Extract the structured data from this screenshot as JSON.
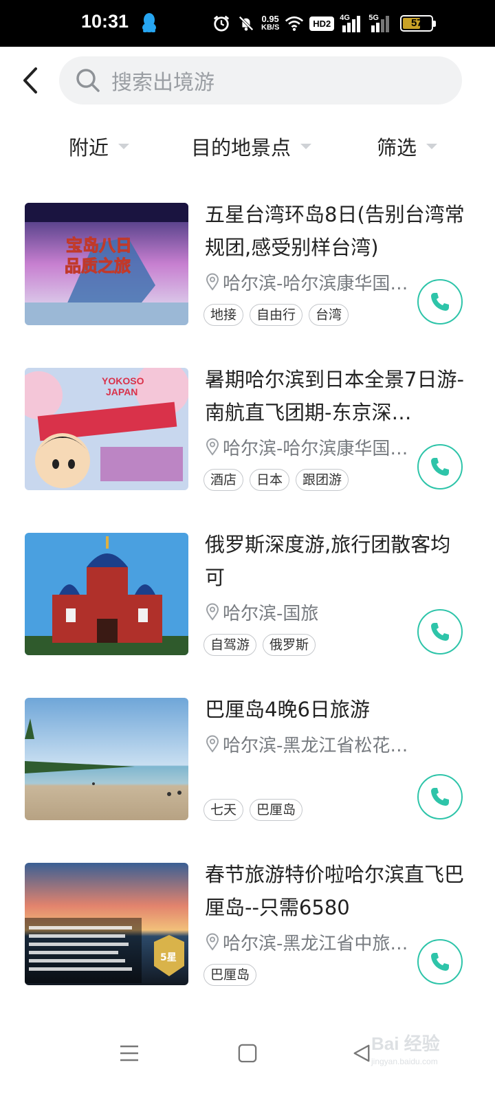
{
  "status_bar": {
    "time": "10:31",
    "net_speed": "0.95",
    "net_speed_unit": "KB/S",
    "hd_label": "HD2",
    "sim1_label": "4G",
    "sim2_label": "5G",
    "battery_level": "57",
    "battery_color": "#c9a227",
    "icons": [
      "qq-icon",
      "alarm-icon",
      "mute-icon",
      "wifi-icon",
      "signal-icon",
      "battery-icon"
    ]
  },
  "header": {
    "back_icon": "chevron-left-icon",
    "search_placeholder": "搜索出境游"
  },
  "filters": [
    {
      "label": "附近"
    },
    {
      "label": "目的地景点"
    },
    {
      "label": "筛选"
    }
  ],
  "accent_color": "#2ec4a9",
  "listings": [
    {
      "title": "五星台湾环岛8日(告别台湾常规团,感受别样台湾)",
      "location": "哈尔滨-哈尔滨康华国…",
      "tags": [
        "地接",
        "自由行",
        "台湾"
      ],
      "image_text": [
        "宝岛八日",
        "品质之旅"
      ]
    },
    {
      "title": "暑期哈尔滨到日本全景7日游-南航直飞团期-东京深…",
      "location": "哈尔滨-哈尔滨康华国…",
      "tags": [
        "酒店",
        "日本",
        "跟团游"
      ],
      "image_text": [
        "YOKOSO",
        "JAPAN"
      ]
    },
    {
      "title": "俄罗斯深度游,旅行团散客均可",
      "location": "哈尔滨-国旅",
      "tags": [
        "自驾游",
        "俄罗斯"
      ],
      "image_text": []
    },
    {
      "title": "巴厘岛4晚6日旅游",
      "location": "哈尔滨-黑龙江省松花…",
      "tags": [
        "七天",
        "巴厘岛"
      ],
      "image_text": []
    },
    {
      "title": "春节旅游特价啦哈尔滨直飞巴厘岛--只需6580",
      "location": "哈尔滨-黑龙江省中旅…",
      "tags": [
        "巴厘岛"
      ],
      "image_text": [
        "5星"
      ]
    }
  ],
  "nav_bar": {
    "icons": [
      "menu-icon",
      "home-icon",
      "back-icon"
    ]
  },
  "watermark": {
    "text": "Bai 经验",
    "sub": "jingyan.baidu.com"
  }
}
